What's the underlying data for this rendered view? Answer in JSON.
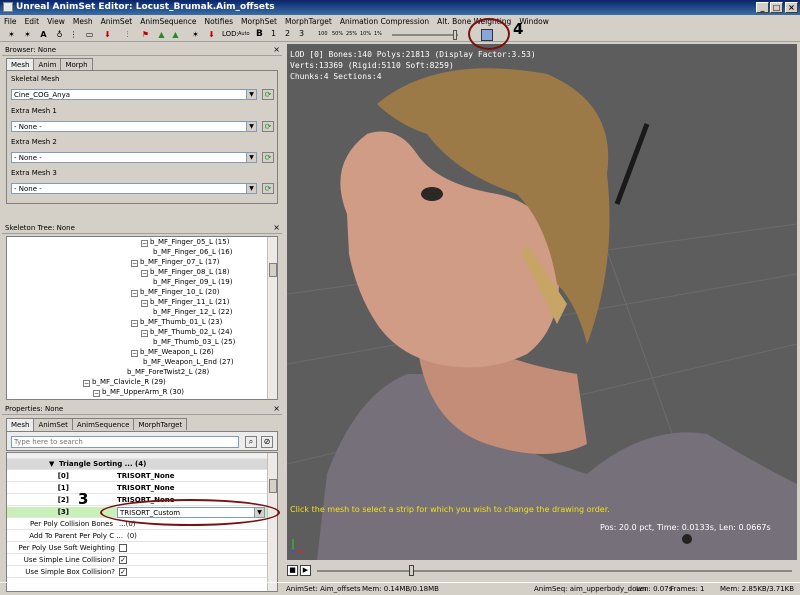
{
  "window": {
    "title": "Unreal AnimSet Editor: Locust_Brumak.Aim_offsets"
  },
  "menu": [
    "File",
    "Edit",
    "View",
    "Mesh",
    "AnimSet",
    "AnimSequence",
    "Notifies",
    "MorphSet",
    "MorphTarget",
    "Animation Compression",
    "Alt. Bone Weighting",
    "Window"
  ],
  "toolbar": {
    "lod_label": "LOD:",
    "lod_auto": "Auto",
    "lod_base": "B",
    "lod1": "1",
    "lod2": "2",
    "lod3": "3",
    "speed": [
      "100",
      "50%",
      "25%",
      "10%",
      "1%"
    ]
  },
  "browser": {
    "header": "Browser: None",
    "tabs": [
      "Mesh",
      "Anim",
      "Morph"
    ],
    "skeletal_mesh_label": "Skeletal Mesh",
    "skeletal_mesh_value": "Cine_COG_Anya",
    "extra1_label": "Extra Mesh 1",
    "extra2_label": "Extra Mesh 2",
    "extra3_label": "Extra Mesh 3",
    "none": "- None -"
  },
  "skeleton": {
    "header": "Skeleton Tree: None",
    "nodes": [
      "b_MF_Finger_05_L (15)",
      "b_MF_Finger_06_L (16)",
      "b_MF_Finger_07_L (17)",
      "b_MF_Finger_08_L (18)",
      "b_MF_Finger_09_L (19)",
      "b_MF_Finger_10_L (20)",
      "b_MF_Finger_11_L (21)",
      "b_MF_Finger_12_L (22)",
      "b_MF_Thumb_01_L (23)",
      "b_MF_Thumb_02_L (24)",
      "b_MF_Thumb_03_L (25)",
      "b_MF_Weapon_L (26)",
      "b_MF_Weapon_L_End (27)",
      "b_MF_ForeTwist2_L (28)",
      "b_MF_Clavicle_R (29)",
      "b_MF_UpperArm_R (30)"
    ]
  },
  "properties": {
    "header": "Properties: None",
    "tabs": [
      "Mesh",
      "AnimSet",
      "AnimSequence",
      "MorphTarget"
    ],
    "search_placeholder": "Type here to search",
    "section": "Triangle Sorting ... (4)",
    "rows": [
      {
        "name": "[0]",
        "value": "TRISORT_None"
      },
      {
        "name": "[1]",
        "value": "TRISORT_None"
      },
      {
        "name": "[2]",
        "value": "TRISORT_None"
      },
      {
        "name": "[3]",
        "value": "TRISORT_Custom"
      }
    ],
    "extra": [
      {
        "name": "Per Poly Collision Bones",
        "value": "...(0)"
      },
      {
        "name": "Add To Parent Per Poly C ...",
        "value": "(0)"
      },
      {
        "name": "Per Poly Use Soft Weighting",
        "value": ""
      },
      {
        "name": "Use Simple Line Collision?",
        "value": ""
      },
      {
        "name": "Use Simple Box Collision?",
        "value": ""
      }
    ]
  },
  "viewport": {
    "info1": "LOD [0] Bones:140 Polys:21813 (Display Factor:3.53)",
    "info2": "Verts:13369 (Rigid:5110 Soft:8259)",
    "info3": "Chunks:4 Sections:4",
    "hint": "Click the mesh to select a strip for which you wish to change the drawing order.",
    "stats": "Pos: 20.0 pct, Time: 0.0133s, Len: 0.0667s"
  },
  "status": {
    "animset": "AnimSet: Aim_offsets",
    "mem1": "Mem: 0.14MB/0.18MB",
    "animseq": "AnimSeq: aim_upperbody_down",
    "len": "Len: 0.07s",
    "frames": "Frames: 1",
    "mem2": "Mem: 2.85KB/3.71KB"
  },
  "annotations": {
    "n3": "3",
    "n4": "4"
  }
}
